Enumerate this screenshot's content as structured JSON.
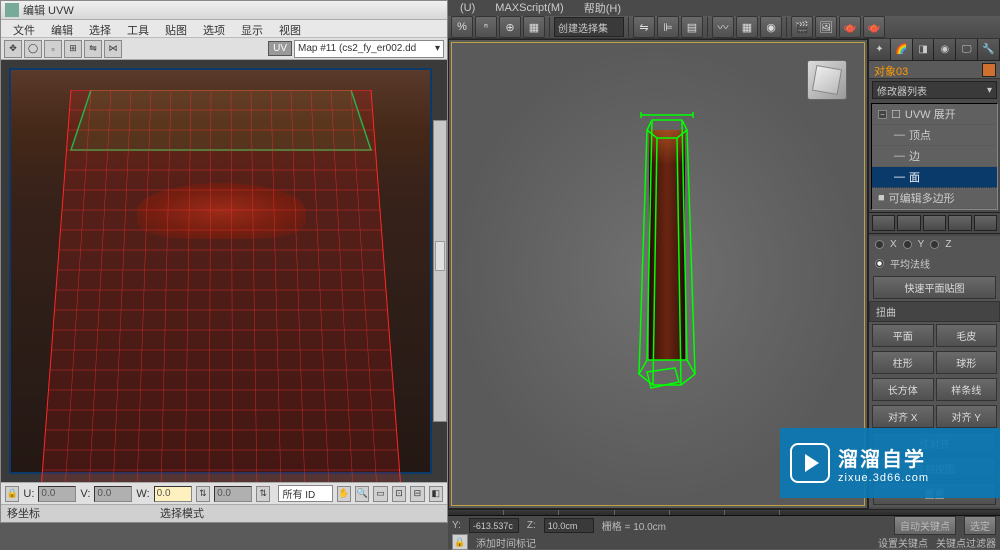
{
  "uvw": {
    "title": "编辑 UVW",
    "menu": [
      "文件",
      "编辑",
      "选择",
      "工具",
      "贴图",
      "选项",
      "显示",
      "视图"
    ],
    "uv_label": "UV",
    "map_dropdown": "Map #11 (cs2_fy_er002.dd",
    "status": {
      "u_label": "U:",
      "u_value": "0.0",
      "v_label": "V:",
      "v_value": "0.0",
      "w_label": "W:",
      "w_value": "0.0",
      "angle_value": "0.0",
      "id_dropdown": "所有 ID"
    },
    "bottom": {
      "left": "移坐标",
      "right": "选择模式"
    }
  },
  "main": {
    "menu": [
      "(U)",
      "MAXScript(M)",
      "帮助(H)"
    ],
    "select_dropdown": "创建选择集",
    "object_name": "对象03",
    "modifier_list_label": "修改器列表",
    "stack": [
      {
        "label": "UVW 展开",
        "expanded": true,
        "children": [
          "顶点",
          "边",
          "面"
        ],
        "selected_child": "面"
      },
      {
        "label": "可编辑多边形",
        "expanded": false
      }
    ],
    "rollout": {
      "axes": {
        "x": "X",
        "y": "Y",
        "z": "Z"
      },
      "avg_normal": "平均法线",
      "quick_planar": "快速平面贴图",
      "warp": "扭曲",
      "plane": "平面",
      "pelt": "毛皮",
      "cylinder": "柱形",
      "sphere": "球形",
      "box": "长方体",
      "spline": "样条线",
      "align_x": "对齐 X",
      "align_y": "对齐 Y",
      "best_align": "佳对齐",
      "align_to_view": "齐到视图",
      "reset": "重置"
    },
    "timeline": {
      "y_coord": "-613.537c",
      "z_coord": "10.0cm",
      "grid": "栅格 = 10.0cm",
      "add_marker": "添加时间标记",
      "auto_key": "自动关键点",
      "selected": "选定",
      "set_key": "设置关键点",
      "key_filter": "关键点过滤器"
    }
  },
  "watermark": {
    "title": "溜溜自学",
    "url": "zixue.3d66.com"
  }
}
